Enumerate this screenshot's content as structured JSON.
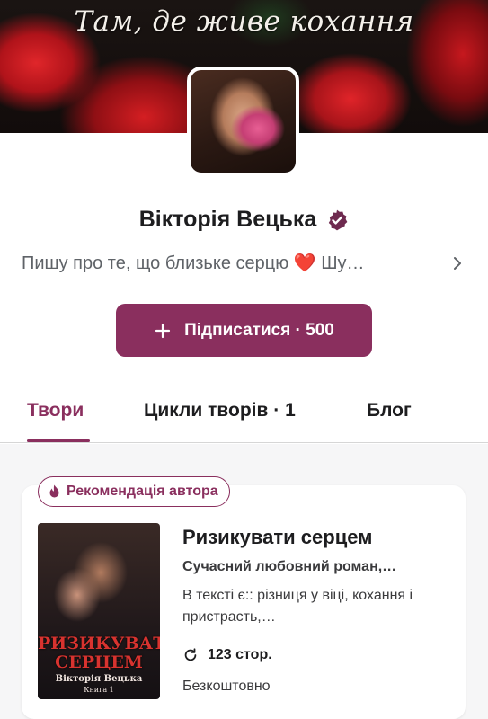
{
  "banner": {
    "title": "Там, де живе кохання"
  },
  "profile": {
    "name": "Вікторія Вецька",
    "bio": "Пишу про те, що близьке серцю ❤️ Шу…"
  },
  "follow": {
    "label": "Підписатися · 500"
  },
  "tabs": [
    {
      "label": "Твори"
    },
    {
      "label": "Цикли творів · 1"
    },
    {
      "label": "Блог"
    }
  ],
  "card": {
    "badge": "Рекомендація автора",
    "cover": {
      "title_line1": "Ризикувати",
      "title_line2": "серцем",
      "author": "Вікторія Вецька",
      "book": "Книга 1"
    },
    "title": "Ризикувати серцем",
    "genre": "Сучасний любовний роман,…",
    "description": "В тексті є:: різниця у віці, кохання і пристрасть,…",
    "pages": "123 стор.",
    "price": "Безкоштовно"
  },
  "colors": {
    "accent": "#8a2f5e"
  },
  "icons": {
    "verified": "verified-badge-icon",
    "chevron": "chevron-right-icon",
    "plus": "plus-icon",
    "flame": "flame-icon",
    "refresh": "refresh-icon"
  }
}
